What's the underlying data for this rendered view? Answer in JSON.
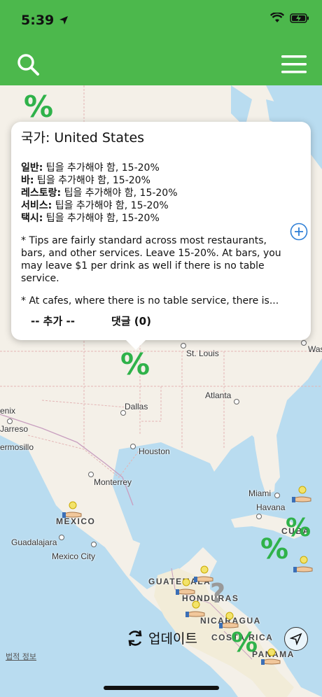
{
  "status": {
    "time": "5:39"
  },
  "nav": {
    "search_icon": "search-icon",
    "menu_icon": "hamburger-menu-icon",
    "brand_color": "#4cb84c"
  },
  "callout": {
    "title": "국가: United States",
    "tips": [
      {
        "label": "일반:",
        "value": " 팁을 추가해야 함, 15-20%"
      },
      {
        "label": "바:",
        "value": " 팁을 추가해야 함, 15-20%"
      },
      {
        "label": "레스토랑:",
        "value": " 팁을 추가해야 함, 15-20%"
      },
      {
        "label": "서비스:",
        "value": " 팁을 추가해야 함, 15-20%"
      },
      {
        "label": "택시:",
        "value": " 팁을 추가해야 함, 15-20%"
      }
    ],
    "note1": "* Tips are fairly standard across most restaurants, bars, and other services. Leave 15-20%. At bars, you may leave $1 per drink as well if there is no table service.",
    "note2": "* At cafes, where there is no table service, there is...",
    "more_label": "-- 추가 --",
    "comments_label": "댓글 (0)"
  },
  "map": {
    "cities": [
      {
        "name": "St. Louis"
      },
      {
        "name": "Atlanta"
      },
      {
        "name": "Dallas"
      },
      {
        "name": "Houston"
      },
      {
        "name": "Monterrey"
      },
      {
        "name": "Miami"
      },
      {
        "name": "Havana"
      },
      {
        "name": "Guadalajara"
      },
      {
        "name": "Mexico City"
      },
      {
        "name": "enix"
      },
      {
        "name": "Jarreso"
      },
      {
        "name": "ermosillo"
      },
      {
        "name": "Was"
      }
    ],
    "countries": [
      {
        "name": "MEXICO"
      },
      {
        "name": "CUBA"
      },
      {
        "name": "GUATEMALA"
      },
      {
        "name": "HONDURAS"
      },
      {
        "name": "NICARAGUA"
      },
      {
        "name": "COSTA RICA"
      },
      {
        "name": "PANAMA"
      }
    ],
    "percent_symbol": "%",
    "question_symbol": "?",
    "legal_label": "법적 정보"
  },
  "bottom": {
    "update_label": "업데이트"
  }
}
